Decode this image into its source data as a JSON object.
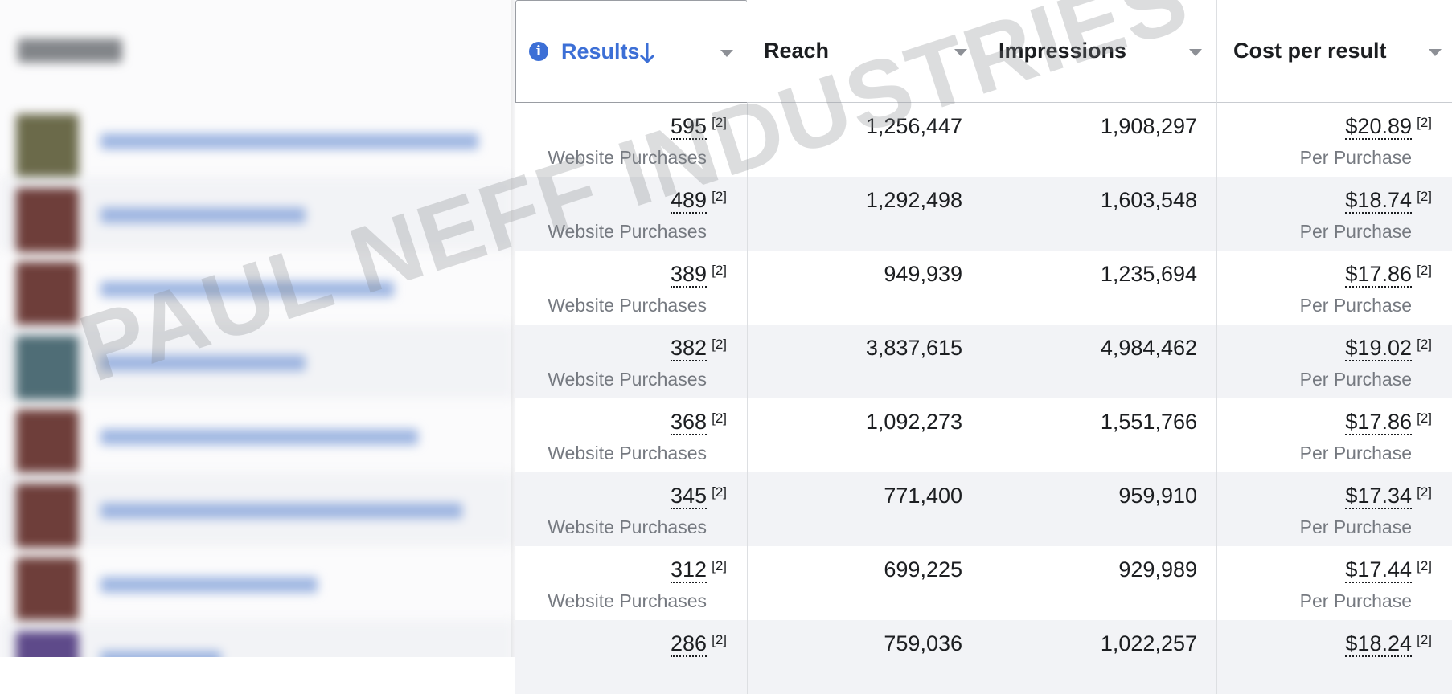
{
  "colors": {
    "accent": "#3c6fd6",
    "row_alt": "#f2f3f6",
    "muted": "#757980"
  },
  "left_pane": {
    "blurred": true,
    "thumb_colors": [
      "#6b6a4a",
      "#6e3e3a",
      "#6e3e3a",
      "#4f6d76",
      "#6e3e3a",
      "#6e3e3a",
      "#6e3e3a",
      "#5e4a8a"
    ]
  },
  "columns": [
    {
      "key": "results",
      "label": "Results",
      "sorted": true,
      "sort_dir": "desc",
      "info_icon": "info-icon"
    },
    {
      "key": "reach",
      "label": "Reach"
    },
    {
      "key": "impressions",
      "label": "Impressions"
    },
    {
      "key": "cost",
      "label": "Cost per result"
    }
  ],
  "footnote": "[2]",
  "rows": [
    {
      "results": "595",
      "results_sub": "Website Purchases",
      "reach": "1,256,447",
      "impressions": "1,908,297",
      "cost": "$20.89",
      "cost_sub": "Per Purchase"
    },
    {
      "results": "489",
      "results_sub": "Website Purchases",
      "reach": "1,292,498",
      "impressions": "1,603,548",
      "cost": "$18.74",
      "cost_sub": "Per Purchase"
    },
    {
      "results": "389",
      "results_sub": "Website Purchases",
      "reach": "949,939",
      "impressions": "1,235,694",
      "cost": "$17.86",
      "cost_sub": "Per Purchase"
    },
    {
      "results": "382",
      "results_sub": "Website Purchases",
      "reach": "3,837,615",
      "impressions": "4,984,462",
      "cost": "$19.02",
      "cost_sub": "Per Purchase"
    },
    {
      "results": "368",
      "results_sub": "Website Purchases",
      "reach": "1,092,273",
      "impressions": "1,551,766",
      "cost": "$17.86",
      "cost_sub": "Per Purchase"
    },
    {
      "results": "345",
      "results_sub": "Website Purchases",
      "reach": "771,400",
      "impressions": "959,910",
      "cost": "$17.34",
      "cost_sub": "Per Purchase"
    },
    {
      "results": "312",
      "results_sub": "Website Purchases",
      "reach": "699,225",
      "impressions": "929,989",
      "cost": "$17.44",
      "cost_sub": "Per Purchase"
    },
    {
      "results": "286",
      "results_sub": "",
      "reach": "759,036",
      "impressions": "1,022,257",
      "cost": "$18.24",
      "cost_sub": ""
    }
  ],
  "watermark": "PAUL NEFF INDUSTRIES"
}
